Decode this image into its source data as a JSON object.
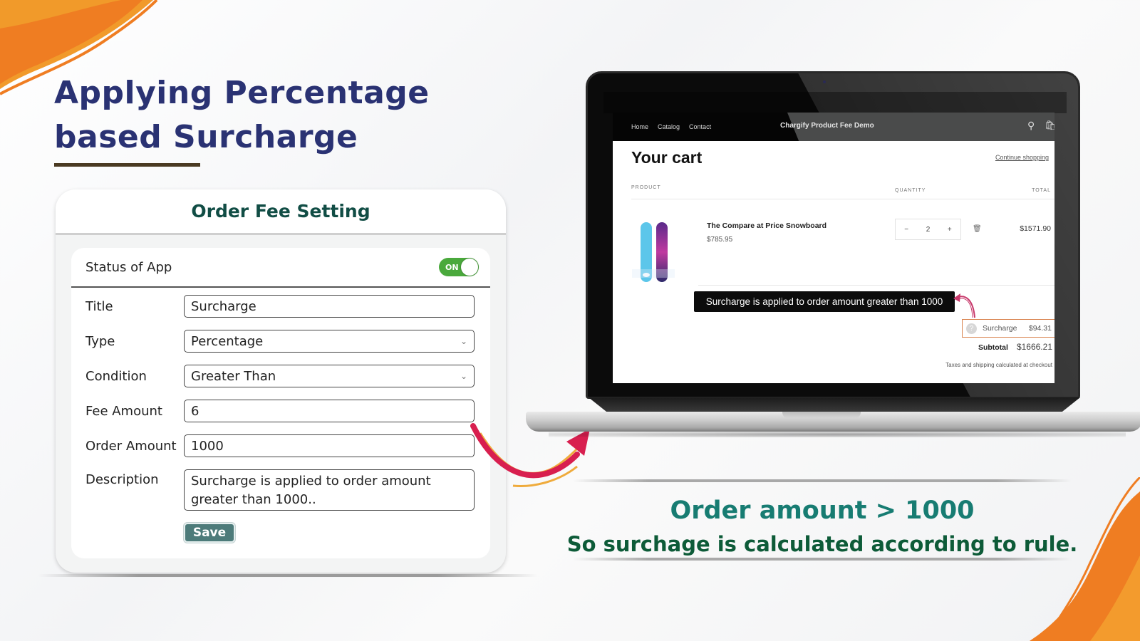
{
  "hero": {
    "title_line1": "Applying Percentage",
    "title_line2": "based Surcharge"
  },
  "settings_card": {
    "title": "Order Fee Setting",
    "status_label": "Status of App",
    "status_toggle": "ON",
    "fields": {
      "title": {
        "label": "Title",
        "value": "Surcharge"
      },
      "type": {
        "label": "Type",
        "value": "Percentage"
      },
      "condition": {
        "label": "Condition",
        "value": "Greater Than"
      },
      "fee_amount": {
        "label": "Fee Amount",
        "value": "6"
      },
      "order_amount": {
        "label": "Order Amount",
        "value": "1000"
      },
      "description": {
        "label": "Description",
        "value": "Surcharge is applied to order amount greater than 1000.."
      }
    },
    "save_label": "Save"
  },
  "store": {
    "nav": [
      "Home",
      "Catalog",
      "Contact"
    ],
    "store_name": "Chargify Product Fee Demo",
    "icons": {
      "search": "search-icon",
      "cart": "shopping-bag-icon"
    },
    "cart_title": "Your cart",
    "continue_shopping": "Continue shopping",
    "columns": {
      "product": "PRODUCT",
      "quantity": "QUANTITY",
      "total": "TOTAL"
    },
    "item": {
      "name": "The Compare at Price Snowboard",
      "price": "$785.95",
      "quantity": "2",
      "minus": "−",
      "plus": "+",
      "line_total": "$1571.90"
    },
    "tooltip": "Surcharge is applied to order amount greater than 1000",
    "surcharge_label": "Surcharge",
    "surcharge_amount": "$94.31",
    "subtotal_label": "Subtotal",
    "subtotal_amount": "$1666.21",
    "tax_note": "Taxes and shipping calculated at checkout"
  },
  "result": {
    "line1": "Order amount > 1000",
    "line2": "So surchage is calculated according to rule."
  },
  "colors": {
    "title_navy": "#2a3273",
    "card_title_green": "#114d45",
    "toggle_green": "#4aa93c",
    "save_teal": "#4d7b7a",
    "result_teal": "#177c72",
    "result_green": "#0d5b38",
    "accent_orange": "#f08a24",
    "arrow_crimson": "#d81f4f",
    "surcharge_border": "#d9834f"
  }
}
